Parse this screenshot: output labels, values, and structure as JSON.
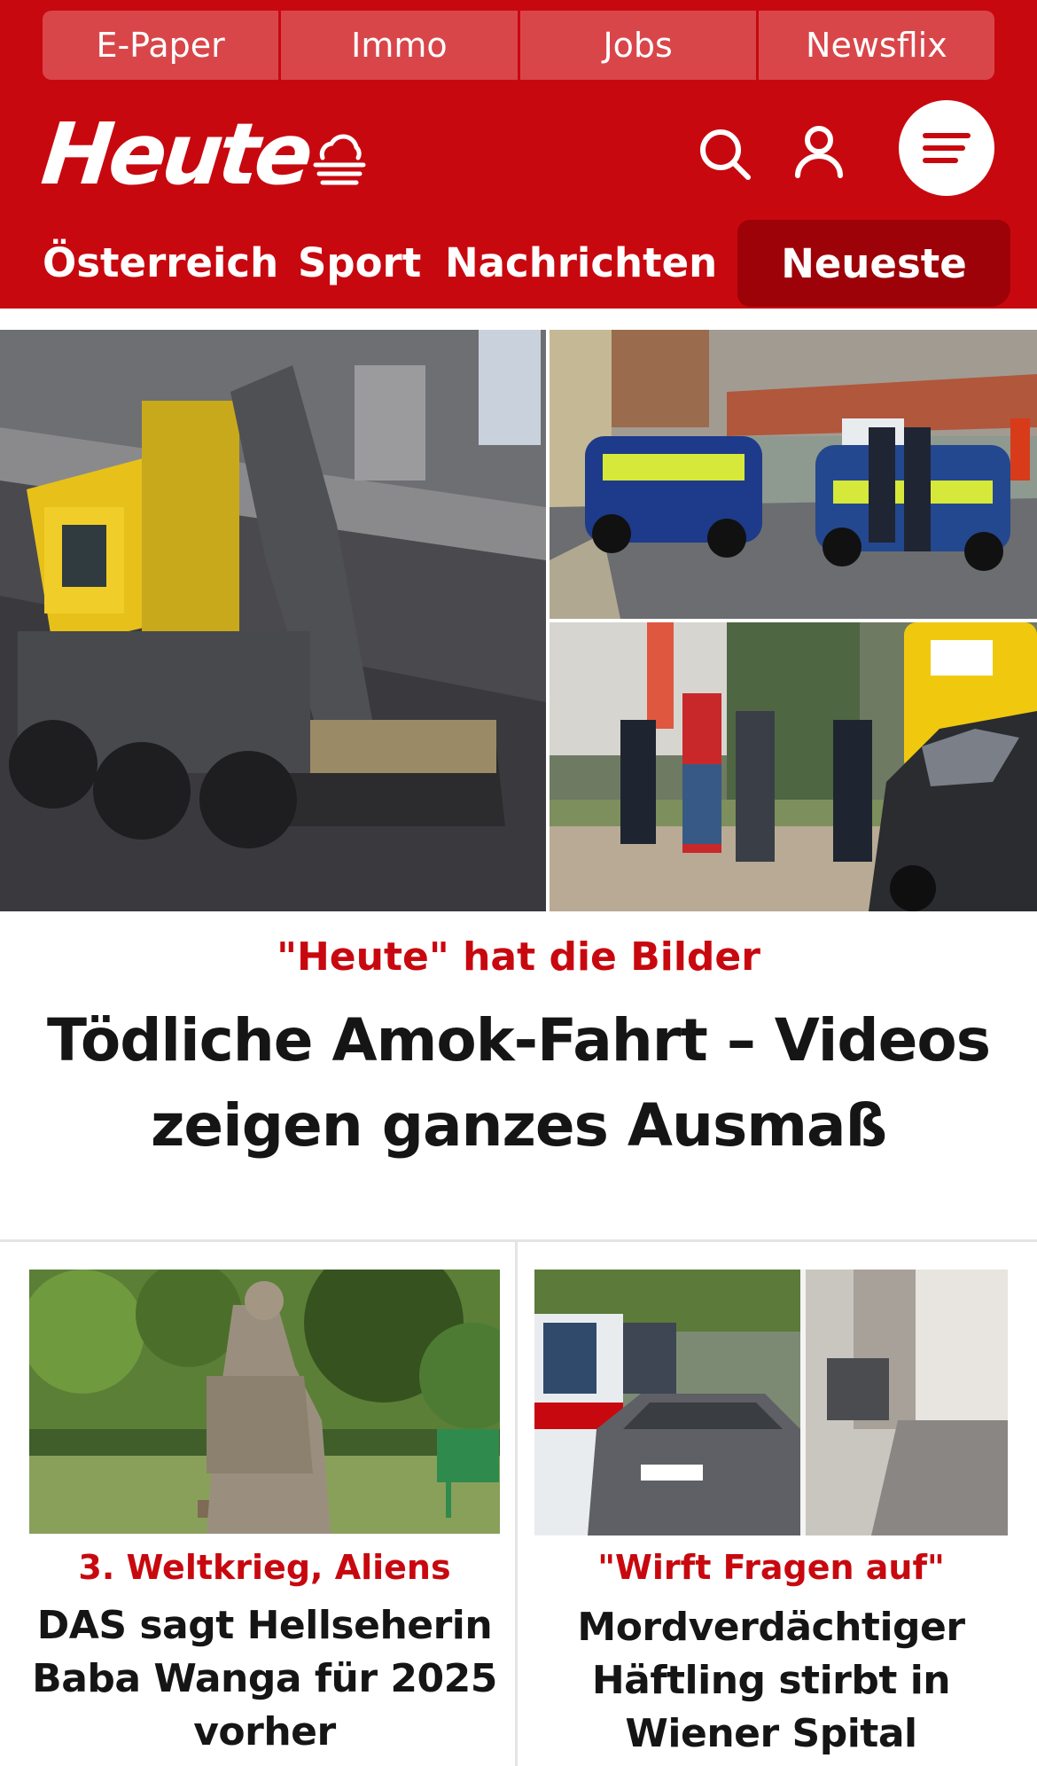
{
  "header": {
    "top_links": [
      "E-Paper",
      "Immo",
      "Jobs",
      "Newsflix"
    ],
    "logo": "Heute",
    "icons": [
      "weather-icon",
      "search-icon",
      "user-icon",
      "menu-icon"
    ],
    "nav": [
      "Österreich",
      "Sport",
      "Nachrichten"
    ],
    "nav_active": "Neueste",
    "colors": {
      "brand": "#c8080f",
      "active_tab": "#9c0208",
      "top_link_bg": "#d9464a"
    }
  },
  "hero": {
    "kicker": "\"Heute\" hat die Bilder",
    "title": "Tödliche Amok-Fahrt – Videos zeigen ganzes Ausmaß"
  },
  "cards": [
    {
      "kicker": "3. Weltkrieg, Aliens",
      "title": "DAS sagt Hellseherin Baba Wanga für 2025 vorher"
    },
    {
      "kicker": "\"Wirft Fragen auf\"",
      "title": "Mordverdächtiger Häftling stirbt in Wiener Spital"
    }
  ]
}
